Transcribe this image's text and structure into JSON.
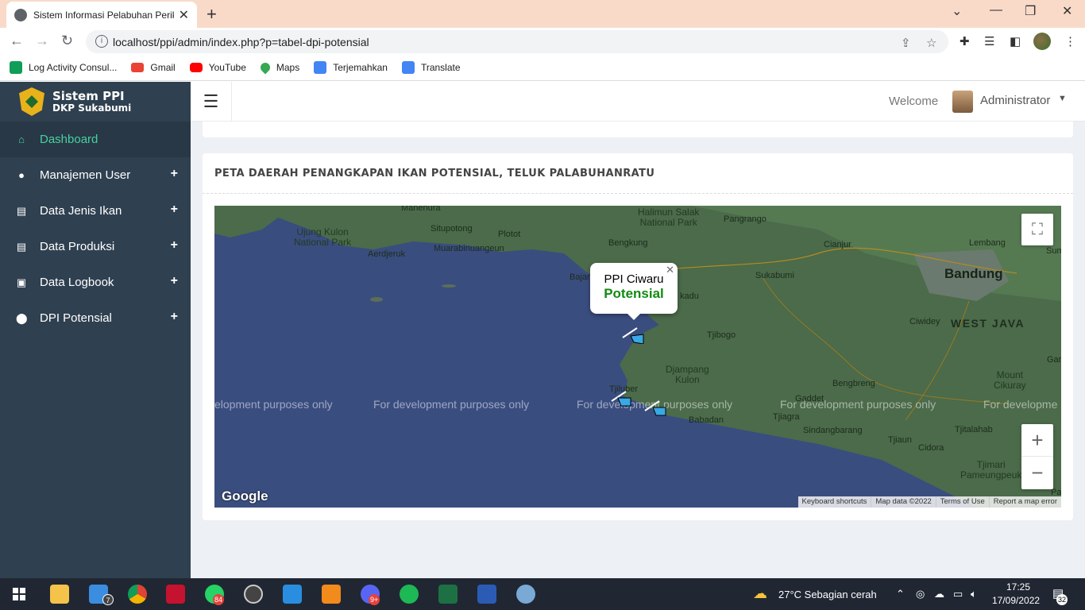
{
  "browser": {
    "tab_title": "Sistem Informasi Pelabuhan Perik",
    "url": "localhost/ppi/admin/index.php?p=tabel-dpi-potensial",
    "bookmarks": [
      {
        "label": "Log Activity Consul...",
        "color": "#0f9d58"
      },
      {
        "label": "Gmail",
        "color": "#ea4335"
      },
      {
        "label": "YouTube",
        "color": "#ff0000"
      },
      {
        "label": "Maps",
        "color": "#34a853"
      },
      {
        "label": "Terjemahkan",
        "color": "#4285f4"
      },
      {
        "label": "Translate",
        "color": "#4285f4"
      }
    ]
  },
  "sidebar": {
    "brand_title": "Sistem PPI",
    "brand_sub": "DKP Sukabumi",
    "items": [
      {
        "label": "Dashboard",
        "icon": "home-icon"
      },
      {
        "label": "Manajemen User",
        "icon": "user-icon"
      },
      {
        "label": "Data Jenis Ikan",
        "icon": "file-icon"
      },
      {
        "label": "Data Produksi",
        "icon": "file-icon"
      },
      {
        "label": "Data Logbook",
        "icon": "archive-icon"
      },
      {
        "label": "DPI Potensial",
        "icon": "map-marker-icon"
      }
    ],
    "expand_glyph": "+"
  },
  "topbar": {
    "welcome": "Welcome",
    "user_name": "Administrator"
  },
  "card": {
    "title": "PETA DAERAH PENANGKAPAN IKAN POTENSIAL, TELUK PALABUHANRATU"
  },
  "map": {
    "popup": {
      "name": "PPI Ciwaru",
      "status": "Potensial"
    },
    "places": {
      "halimun": "Halimun Salak\nNational Park",
      "ujung_kulon": "Ujung Kulon\nNational Park",
      "pangrango": "Pangrango",
      "manenura": "Manenura",
      "situpotong": "Situpotong",
      "plotot": "Plotot",
      "aerdjeruk": "Aerdjeruk",
      "muarabinuangeun": "Muarabinuangeun",
      "bengkung": "Bengkung",
      "cianjur": "Cianjur",
      "lembang": "Lembang",
      "sum": "Sum",
      "bandung": "Bandung",
      "sukabumi": "Sukabumi",
      "bajar": "Bajar",
      "kadu": "kadu",
      "ciwidey": "Ciwidey",
      "west_java": "WEST JAVA",
      "tjibogo": "Tjibogo",
      "djampang_kulon": "Djampang\nKulon",
      "bengbreng": "Bengbreng",
      "gar": "Gar",
      "mount_cikuray": "Mount\nCikuray",
      "tjiluber": "Tjiluber",
      "gaddet": "Gaddet",
      "babadan": "Babadan",
      "tjiagra": "Tjiagra",
      "sindangbarang": "Sindangbarang",
      "tjitalahab": "Tjitalahab",
      "tjiaun": "Tjiaun",
      "cidora": "Cidora",
      "tjimari": "Tjimari\nPameungpeuk",
      "par": "Par"
    },
    "watermark": "For development purposes only",
    "watermark_first": "elopment purposes only",
    "watermark_last": "For developme",
    "google": "Google",
    "attribution": [
      "Keyboard shortcuts",
      "Map data ©2022",
      "Terms of Use",
      "Report a map error"
    ],
    "zoom_in": "+",
    "zoom_out": "−"
  },
  "taskbar": {
    "weather": "27°C  Sebagian cerah",
    "time": "17:25",
    "date": "17/09/2022",
    "mail_badge": "7",
    "whatsapp_badge": "84",
    "discord_badge": "9+",
    "notif_count": "32"
  }
}
